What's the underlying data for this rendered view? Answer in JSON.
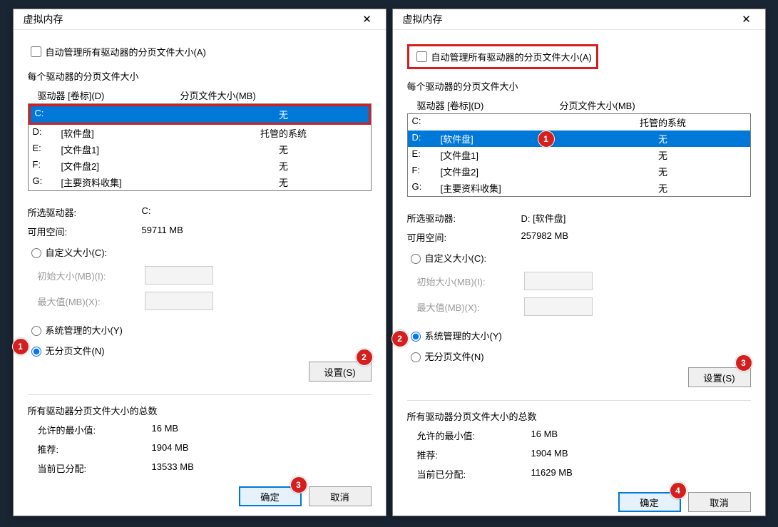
{
  "left": {
    "title": "虚拟内存",
    "auto_label": "自动管理所有驱动器的分页文件大小(A)",
    "subhead": "每个驱动器的分页文件大小",
    "col_drive": "驱动器 [卷标](D)",
    "col_size": "分页文件大小(MB)",
    "rows": [
      {
        "d": "C:",
        "l": "",
        "s": "无",
        "sel": true
      },
      {
        "d": "D:",
        "l": "[软件盘]",
        "s": "托管的系统",
        "sel": false
      },
      {
        "d": "E:",
        "l": "[文件盘1]",
        "s": "无",
        "sel": false
      },
      {
        "d": "F:",
        "l": "[文件盘2]",
        "s": "无",
        "sel": false
      },
      {
        "d": "G:",
        "l": "[主要资料收集]",
        "s": "无",
        "sel": false
      }
    ],
    "sel_drive_k": "所选驱动器:",
    "sel_drive_v": "C:",
    "free_k": "可用空间:",
    "free_v": "59711 MB",
    "custom": "自定义大小(C):",
    "init": "初始大小(MB)(I):",
    "max": "最大值(MB)(X):",
    "sysmgd": "系统管理的大小(Y)",
    "nopage": "无分页文件(N)",
    "setbtn": "设置(S)",
    "total_head": "所有驱动器分页文件大小的总数",
    "min_k": "允许的最小值:",
    "min_v": "16 MB",
    "rec_k": "推荐:",
    "rec_v": "1904 MB",
    "cur_k": "当前已分配:",
    "cur_v": "13533 MB",
    "ok": "确定",
    "cancel": "取消",
    "badges": {
      "b1": "1",
      "b2": "2",
      "b3": "3"
    }
  },
  "right": {
    "title": "虚拟内存",
    "auto_label": "自动管理所有驱动器的分页文件大小(A)",
    "subhead": "每个驱动器的分页文件大小",
    "col_drive": "驱动器 [卷标](D)",
    "col_size": "分页文件大小(MB)",
    "rows": [
      {
        "d": "C:",
        "l": "",
        "s": "托管的系统",
        "sel": false
      },
      {
        "d": "D:",
        "l": "[软件盘]",
        "s": "无",
        "sel": true
      },
      {
        "d": "E:",
        "l": "[文件盘1]",
        "s": "无",
        "sel": false
      },
      {
        "d": "F:",
        "l": "[文件盘2]",
        "s": "无",
        "sel": false
      },
      {
        "d": "G:",
        "l": "[主要资料收集]",
        "s": "无",
        "sel": false
      }
    ],
    "sel_drive_k": "所选驱动器:",
    "sel_drive_v": "D:  [软件盘]",
    "free_k": "可用空间:",
    "free_v": "257982 MB",
    "custom": "自定义大小(C):",
    "init": "初始大小(MB)(I):",
    "max": "最大值(MB)(X):",
    "sysmgd": "系统管理的大小(Y)",
    "nopage": "无分页文件(N)",
    "setbtn": "设置(S)",
    "total_head": "所有驱动器分页文件大小的总数",
    "min_k": "允许的最小值:",
    "min_v": "16 MB",
    "rec_k": "推荐:",
    "rec_v": "1904 MB",
    "cur_k": "当前已分配:",
    "cur_v": "11629 MB",
    "ok": "确定",
    "cancel": "取消",
    "badges": {
      "b1": "1",
      "b2": "2",
      "b3": "3",
      "b4": "4"
    }
  }
}
